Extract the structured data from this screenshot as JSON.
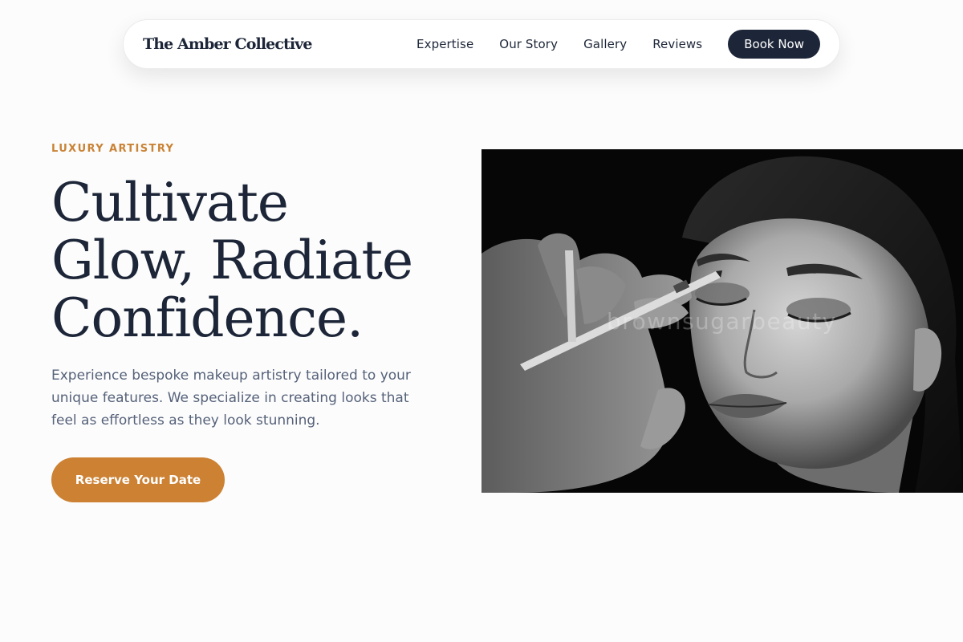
{
  "nav": {
    "brand": "The Amber Collective",
    "links": [
      {
        "label": "Expertise"
      },
      {
        "label": "Our Story"
      },
      {
        "label": "Gallery"
      },
      {
        "label": "Reviews"
      }
    ],
    "cta_label": "Book Now"
  },
  "hero": {
    "eyebrow": "LUXURY ARTISTRY",
    "headline_lines": [
      "Cultivate",
      "Glow, Radiate",
      "Confidence."
    ],
    "description": "Experience bespoke makeup artistry tailored to your unique features. We specialize in creating looks that feel as effortless as they look stunning.",
    "cta_label": "Reserve Your Date",
    "image": {
      "subject": "black-and-white photo of a makeup artist applying eye pencil to a woman with closed eyes",
      "watermark": "brownsugarbeauty"
    }
  },
  "colors": {
    "accent": "#cc8133",
    "navy": "#1d2638",
    "body_text": "#56627a",
    "background": "#fcfcfc"
  }
}
